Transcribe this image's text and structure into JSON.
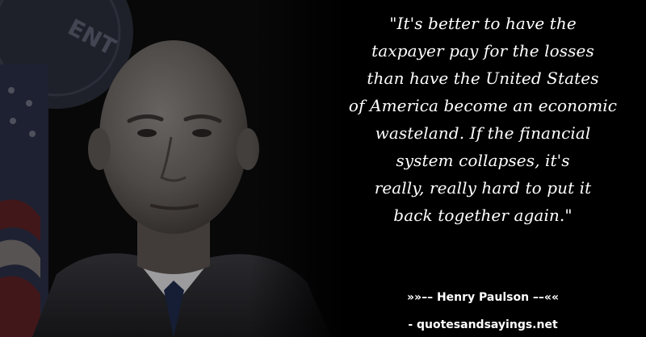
{
  "quote": {
    "lines": [
      "\"It's better to have the",
      "taxpayer pay for the losses",
      "than have the United States",
      "of America become an economic",
      "wasteland. If the financial",
      "system collapses, it's",
      "really, really hard to put it",
      "back together again.\""
    ]
  },
  "attribution": "»»–– Henry Paulson ––««",
  "site": "- quotesandsayings.net",
  "colors": {
    "background": "#000000",
    "text": "#ffffff"
  }
}
